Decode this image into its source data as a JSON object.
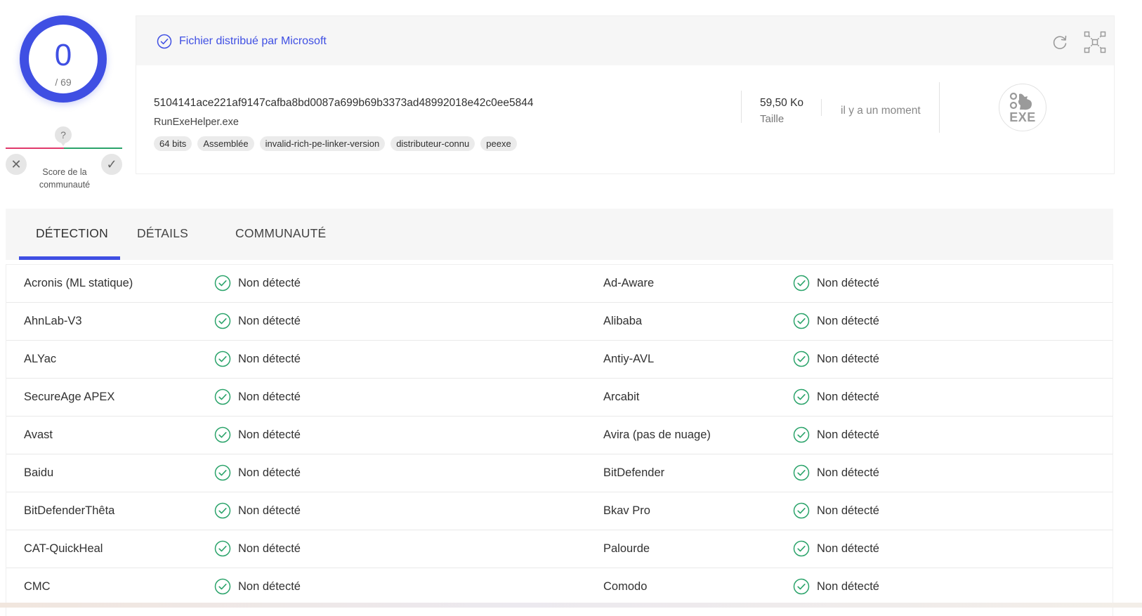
{
  "score": {
    "detections": "0",
    "total": "/ 69"
  },
  "community": {
    "question": "?",
    "label": "Score de la communauté",
    "down": "✕",
    "up": "✓"
  },
  "file": {
    "verified_text": "Fichier distribué par Microsoft",
    "hash": "5104141ace221af9147cafba8bd0087a699b69b3373ad48992018e42c0ee5844",
    "name": "RunExeHelper.exe",
    "tags": [
      "64 bits",
      "Assemblée",
      "invalid-rich-pe-linker-version",
      "distributeur-connu",
      "peexe"
    ],
    "size_value": "59,50 Ko",
    "size_label": "Taille",
    "date": "il y a un moment",
    "type_badge": "EXE"
  },
  "tabs": [
    {
      "label": "DÉTECTION",
      "active": true
    },
    {
      "label": "DÉTAILS",
      "active": false
    },
    {
      "label": "COMMUNAUTÉ",
      "active": false
    }
  ],
  "detections": [
    {
      "left_engine": "Acronis (ML statique)",
      "left_result": "Non détecté",
      "right_engine": "Ad-Aware",
      "right_result": "Non détecté"
    },
    {
      "left_engine": "AhnLab-V3",
      "left_result": "Non détecté",
      "right_engine": "Alibaba",
      "right_result": "Non détecté"
    },
    {
      "left_engine": "ALYac",
      "left_result": "Non détecté",
      "right_engine": "Antiy-AVL",
      "right_result": "Non détecté"
    },
    {
      "left_engine": "SecureAge APEX",
      "left_result": "Non détecté",
      "right_engine": "Arcabit",
      "right_result": "Non détecté"
    },
    {
      "left_engine": "Avast",
      "left_result": "Non détecté",
      "right_engine": "Avira (pas de nuage)",
      "right_result": "Non détecté"
    },
    {
      "left_engine": "Baidu",
      "left_result": "Non détecté",
      "right_engine": "BitDefender",
      "right_result": "Non détecté"
    },
    {
      "left_engine": "BitDefenderThêta",
      "left_result": "Non détecté",
      "right_engine": "Bkav Pro",
      "right_result": "Non détecté"
    },
    {
      "left_engine": "CAT-QuickHeal",
      "left_result": "Non détecté",
      "right_engine": "Palourde",
      "right_result": "Non détecté"
    },
    {
      "left_engine": "CMC",
      "left_result": "Non détecté",
      "right_engine": "Comodo",
      "right_result": "Non détecté"
    }
  ],
  "colors": {
    "accent": "#3f4fe3",
    "clean": "#2aa36a",
    "malicious": "#e0396b"
  }
}
